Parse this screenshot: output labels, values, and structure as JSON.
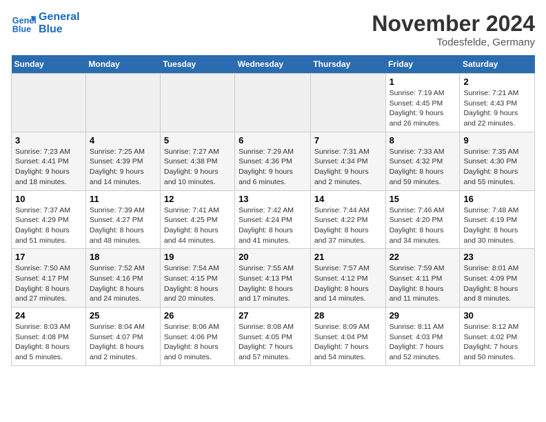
{
  "header": {
    "logo_line1": "General",
    "logo_line2": "Blue",
    "month": "November 2024",
    "location": "Todesfelde, Germany"
  },
  "weekdays": [
    "Sunday",
    "Monday",
    "Tuesday",
    "Wednesday",
    "Thursday",
    "Friday",
    "Saturday"
  ],
  "weeks": [
    [
      {
        "day": "",
        "empty": true
      },
      {
        "day": "",
        "empty": true
      },
      {
        "day": "",
        "empty": true
      },
      {
        "day": "",
        "empty": true
      },
      {
        "day": "",
        "empty": true
      },
      {
        "day": "1",
        "sunrise": "Sunrise: 7:19 AM",
        "sunset": "Sunset: 4:45 PM",
        "daylight": "Daylight: 9 hours and 26 minutes."
      },
      {
        "day": "2",
        "sunrise": "Sunrise: 7:21 AM",
        "sunset": "Sunset: 4:43 PM",
        "daylight": "Daylight: 9 hours and 22 minutes."
      }
    ],
    [
      {
        "day": "3",
        "sunrise": "Sunrise: 7:23 AM",
        "sunset": "Sunset: 4:41 PM",
        "daylight": "Daylight: 9 hours and 18 minutes."
      },
      {
        "day": "4",
        "sunrise": "Sunrise: 7:25 AM",
        "sunset": "Sunset: 4:39 PM",
        "daylight": "Daylight: 9 hours and 14 minutes."
      },
      {
        "day": "5",
        "sunrise": "Sunrise: 7:27 AM",
        "sunset": "Sunset: 4:38 PM",
        "daylight": "Daylight: 9 hours and 10 minutes."
      },
      {
        "day": "6",
        "sunrise": "Sunrise: 7:29 AM",
        "sunset": "Sunset: 4:36 PM",
        "daylight": "Daylight: 9 hours and 6 minutes."
      },
      {
        "day": "7",
        "sunrise": "Sunrise: 7:31 AM",
        "sunset": "Sunset: 4:34 PM",
        "daylight": "Daylight: 9 hours and 2 minutes."
      },
      {
        "day": "8",
        "sunrise": "Sunrise: 7:33 AM",
        "sunset": "Sunset: 4:32 PM",
        "daylight": "Daylight: 8 hours and 59 minutes."
      },
      {
        "day": "9",
        "sunrise": "Sunrise: 7:35 AM",
        "sunset": "Sunset: 4:30 PM",
        "daylight": "Daylight: 8 hours and 55 minutes."
      }
    ],
    [
      {
        "day": "10",
        "sunrise": "Sunrise: 7:37 AM",
        "sunset": "Sunset: 4:29 PM",
        "daylight": "Daylight: 8 hours and 51 minutes."
      },
      {
        "day": "11",
        "sunrise": "Sunrise: 7:39 AM",
        "sunset": "Sunset: 4:27 PM",
        "daylight": "Daylight: 8 hours and 48 minutes."
      },
      {
        "day": "12",
        "sunrise": "Sunrise: 7:41 AM",
        "sunset": "Sunset: 4:25 PM",
        "daylight": "Daylight: 8 hours and 44 minutes."
      },
      {
        "day": "13",
        "sunrise": "Sunrise: 7:42 AM",
        "sunset": "Sunset: 4:24 PM",
        "daylight": "Daylight: 8 hours and 41 minutes."
      },
      {
        "day": "14",
        "sunrise": "Sunrise: 7:44 AM",
        "sunset": "Sunset: 4:22 PM",
        "daylight": "Daylight: 8 hours and 37 minutes."
      },
      {
        "day": "15",
        "sunrise": "Sunrise: 7:46 AM",
        "sunset": "Sunset: 4:20 PM",
        "daylight": "Daylight: 8 hours and 34 minutes."
      },
      {
        "day": "16",
        "sunrise": "Sunrise: 7:48 AM",
        "sunset": "Sunset: 4:19 PM",
        "daylight": "Daylight: 8 hours and 30 minutes."
      }
    ],
    [
      {
        "day": "17",
        "sunrise": "Sunrise: 7:50 AM",
        "sunset": "Sunset: 4:17 PM",
        "daylight": "Daylight: 8 hours and 27 minutes."
      },
      {
        "day": "18",
        "sunrise": "Sunrise: 7:52 AM",
        "sunset": "Sunset: 4:16 PM",
        "daylight": "Daylight: 8 hours and 24 minutes."
      },
      {
        "day": "19",
        "sunrise": "Sunrise: 7:54 AM",
        "sunset": "Sunset: 4:15 PM",
        "daylight": "Daylight: 8 hours and 20 minutes."
      },
      {
        "day": "20",
        "sunrise": "Sunrise: 7:55 AM",
        "sunset": "Sunset: 4:13 PM",
        "daylight": "Daylight: 8 hours and 17 minutes."
      },
      {
        "day": "21",
        "sunrise": "Sunrise: 7:57 AM",
        "sunset": "Sunset: 4:12 PM",
        "daylight": "Daylight: 8 hours and 14 minutes."
      },
      {
        "day": "22",
        "sunrise": "Sunrise: 7:59 AM",
        "sunset": "Sunset: 4:11 PM",
        "daylight": "Daylight: 8 hours and 11 minutes."
      },
      {
        "day": "23",
        "sunrise": "Sunrise: 8:01 AM",
        "sunset": "Sunset: 4:09 PM",
        "daylight": "Daylight: 8 hours and 8 minutes."
      }
    ],
    [
      {
        "day": "24",
        "sunrise": "Sunrise: 8:03 AM",
        "sunset": "Sunset: 4:08 PM",
        "daylight": "Daylight: 8 hours and 5 minutes."
      },
      {
        "day": "25",
        "sunrise": "Sunrise: 8:04 AM",
        "sunset": "Sunset: 4:07 PM",
        "daylight": "Daylight: 8 hours and 2 minutes."
      },
      {
        "day": "26",
        "sunrise": "Sunrise: 8:06 AM",
        "sunset": "Sunset: 4:06 PM",
        "daylight": "Daylight: 8 hours and 0 minutes."
      },
      {
        "day": "27",
        "sunrise": "Sunrise: 8:08 AM",
        "sunset": "Sunset: 4:05 PM",
        "daylight": "Daylight: 7 hours and 57 minutes."
      },
      {
        "day": "28",
        "sunrise": "Sunrise: 8:09 AM",
        "sunset": "Sunset: 4:04 PM",
        "daylight": "Daylight: 7 hours and 54 minutes."
      },
      {
        "day": "29",
        "sunrise": "Sunrise: 8:11 AM",
        "sunset": "Sunset: 4:03 PM",
        "daylight": "Daylight: 7 hours and 52 minutes."
      },
      {
        "day": "30",
        "sunrise": "Sunrise: 8:12 AM",
        "sunset": "Sunset: 4:02 PM",
        "daylight": "Daylight: 7 hours and 50 minutes."
      }
    ]
  ]
}
